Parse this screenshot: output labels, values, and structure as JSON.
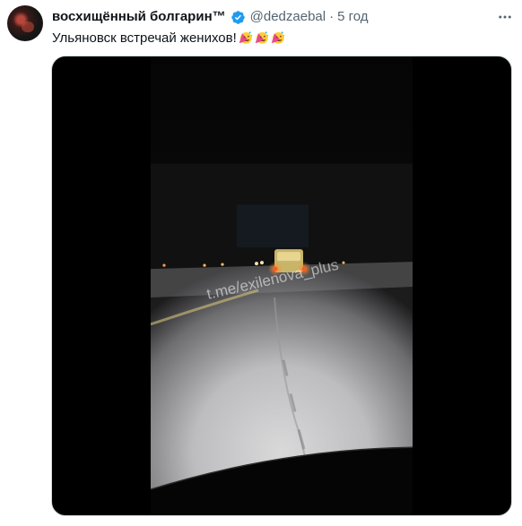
{
  "author": {
    "display_name": "восхищённый болгарин™",
    "handle": "@dedzaebal",
    "separator": "·",
    "timestamp": "5 год",
    "verified": true
  },
  "tweet": {
    "text": "Ульяновск встречай женихов!",
    "emoji": [
      "partying-face-emoji",
      "partying-face-emoji",
      "partying-face-emoji"
    ]
  },
  "media": {
    "watermark": "t.me/exilenova_plus"
  },
  "colors": {
    "verified": "#1d9bf0",
    "secondary_text": "#536471",
    "text": "#0f1419"
  }
}
